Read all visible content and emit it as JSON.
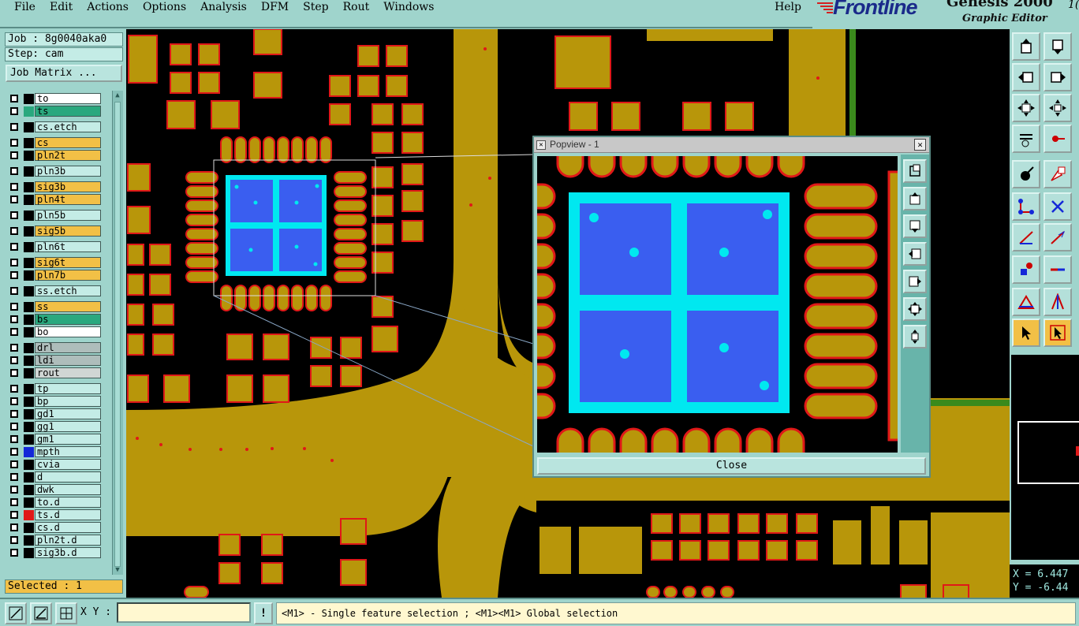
{
  "menu": {
    "items": [
      "File",
      "Edit",
      "Actions",
      "Options",
      "Analysis",
      "DFM",
      "Step",
      "Rout",
      "Windows"
    ],
    "help": "Help"
  },
  "brand": {
    "logo": "Frontline",
    "title": "Genesis 2000",
    "subtitle": "Graphic Editor",
    "version_fragment": "1("
  },
  "job": {
    "label": "Job : 8g0040aka0",
    "step": "Step: cam",
    "matrix_button": "Job Matrix ..."
  },
  "layers": [
    {
      "name": "to",
      "color": "#ffffff",
      "swatch": "#000000"
    },
    {
      "name": "ts",
      "color": "#2aa87e",
      "swatch": "#2aa87e"
    },
    {
      "name": "cs.etch",
      "color": "#c4ece6",
      "swatch": "#000000"
    },
    {
      "name": "cs",
      "color": "#f2c046",
      "swatch": "#000000"
    },
    {
      "name": "pln2t",
      "color": "#f2c046",
      "swatch": "#000000"
    },
    {
      "name": "pln3b",
      "color": "#c4ece6",
      "swatch": "#000000"
    },
    {
      "name": "sig3b",
      "color": "#f2c046",
      "swatch": "#000000"
    },
    {
      "name": "pln4t",
      "color": "#f2c046",
      "swatch": "#000000"
    },
    {
      "name": "pln5b",
      "color": "#c4ece6",
      "swatch": "#000000"
    },
    {
      "name": "sig5b",
      "color": "#f2c046",
      "swatch": "#000000"
    },
    {
      "name": "pln6t",
      "color": "#c4ece6",
      "swatch": "#000000"
    },
    {
      "name": "sig6t",
      "color": "#f2c046",
      "swatch": "#000000"
    },
    {
      "name": "pln7b",
      "color": "#f2c046",
      "swatch": "#000000"
    },
    {
      "name": "ss.etch",
      "color": "#c4ece6",
      "swatch": "#000000"
    },
    {
      "name": "ss",
      "color": "#f2c046",
      "swatch": "#000000"
    },
    {
      "name": "bs",
      "color": "#2aa87e",
      "swatch": "#000000"
    },
    {
      "name": "bo",
      "color": "#ffffff",
      "swatch": "#000000"
    },
    {
      "name": "drl",
      "color": "#aebdbb",
      "swatch": "#000000"
    },
    {
      "name": "ldi",
      "color": "#aebdbb",
      "swatch": "#000000"
    },
    {
      "name": "rout",
      "color": "#d0d6d4",
      "swatch": "#000000"
    },
    {
      "name": "tp",
      "color": "#c4ece6",
      "swatch": "#000000"
    },
    {
      "name": "bp",
      "color": "#c4ece6",
      "swatch": "#000000"
    },
    {
      "name": "gd1",
      "color": "#c4ece6",
      "swatch": "#000000"
    },
    {
      "name": "gg1",
      "color": "#c4ece6",
      "swatch": "#000000"
    },
    {
      "name": "gm1",
      "color": "#c4ece6",
      "swatch": "#000000"
    },
    {
      "name": "mpth",
      "color": "#c4ece6",
      "swatch": "#1428d8"
    },
    {
      "name": "cvia",
      "color": "#c4ece6",
      "swatch": "#000000"
    },
    {
      "name": "d",
      "color": "#c4ece6",
      "swatch": "#000000"
    },
    {
      "name": "dwk",
      "color": "#c4ece6",
      "swatch": "#000000"
    },
    {
      "name": "to.d",
      "color": "#c4ece6",
      "swatch": "#000000"
    },
    {
      "name": "ts.d",
      "color": "#c4ece6",
      "swatch": "#e01818"
    },
    {
      "name": "cs.d",
      "color": "#c4ece6",
      "swatch": "#000000"
    },
    {
      "name": "pln2t.d",
      "color": "#c4ece6",
      "swatch": "#000000"
    },
    {
      "name": "sig3b.d",
      "color": "#c4ece6",
      "swatch": "#000000"
    }
  ],
  "selected": "Selected : 1",
  "popview": {
    "title": "Popview - 1",
    "close_label": "Close"
  },
  "coords": {
    "x": "X = 6.447",
    "y": "Y = -6.44"
  },
  "statusbar": {
    "xy_label": "X Y :",
    "xy_value": "",
    "prompt": "<M1> - Single feature selection ; <M1><M1> Global selection"
  },
  "colors": {
    "board_copper": "#b8960a",
    "pad_outline": "#e01818",
    "background": "#000000",
    "ui_teal": "#9fd4cc",
    "popview_cyan": "#00e8f0",
    "popview_blue": "#3a5ef0",
    "active_tool": "#f2c046"
  }
}
